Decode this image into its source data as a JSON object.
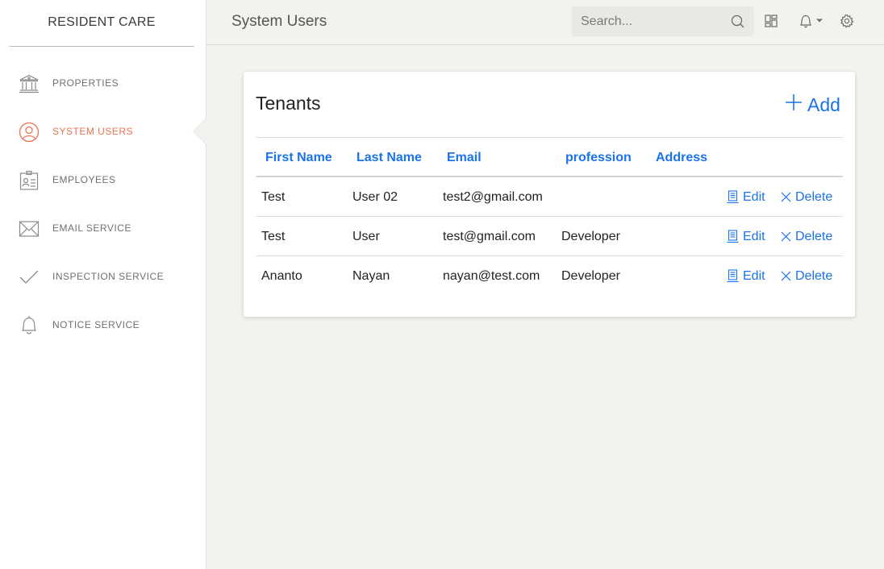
{
  "app": {
    "brand": "RESIDENT CARE"
  },
  "sidebar": {
    "items": [
      {
        "label": "PROPERTIES",
        "icon": "bank-icon",
        "active": false
      },
      {
        "label": "SYSTEM USERS",
        "icon": "user-circle-icon",
        "active": true
      },
      {
        "label": "EMPLOYEES",
        "icon": "id-card-icon",
        "active": false
      },
      {
        "label": "EMAIL SERVICE",
        "icon": "envelope-icon",
        "active": false
      },
      {
        "label": "INSPECTION SERVICE",
        "icon": "checkmark-icon",
        "active": false
      },
      {
        "label": "NOTICE SERVICE",
        "icon": "bell-icon",
        "active": false
      }
    ]
  },
  "header": {
    "title": "System Users",
    "search": {
      "placeholder": "Search...",
      "value": ""
    }
  },
  "card": {
    "title": "Tenants",
    "add_label": "Add"
  },
  "table": {
    "columns": [
      "First Name",
      "Last Name",
      "Email",
      "profession",
      "Address"
    ],
    "rows": [
      {
        "first": "Test",
        "last": "User 02",
        "email": "test2@gmail.com",
        "profession": "",
        "address": "",
        "edit": "Edit",
        "delete": "Delete"
      },
      {
        "first": "Test",
        "last": "User",
        "email": "test@gmail.com",
        "profession": "Developer",
        "address": "",
        "edit": "Edit",
        "delete": "Delete"
      },
      {
        "first": "Ananto",
        "last": "Nayan",
        "email": "nayan@test.com",
        "profession": "Developer",
        "address": "",
        "edit": "Edit",
        "delete": "Delete"
      }
    ]
  },
  "colors": {
    "accent": "#1a73e8",
    "active_nav": "#e87452",
    "nav_text": "#6f6f6f",
    "background": "#f3f2ef"
  }
}
